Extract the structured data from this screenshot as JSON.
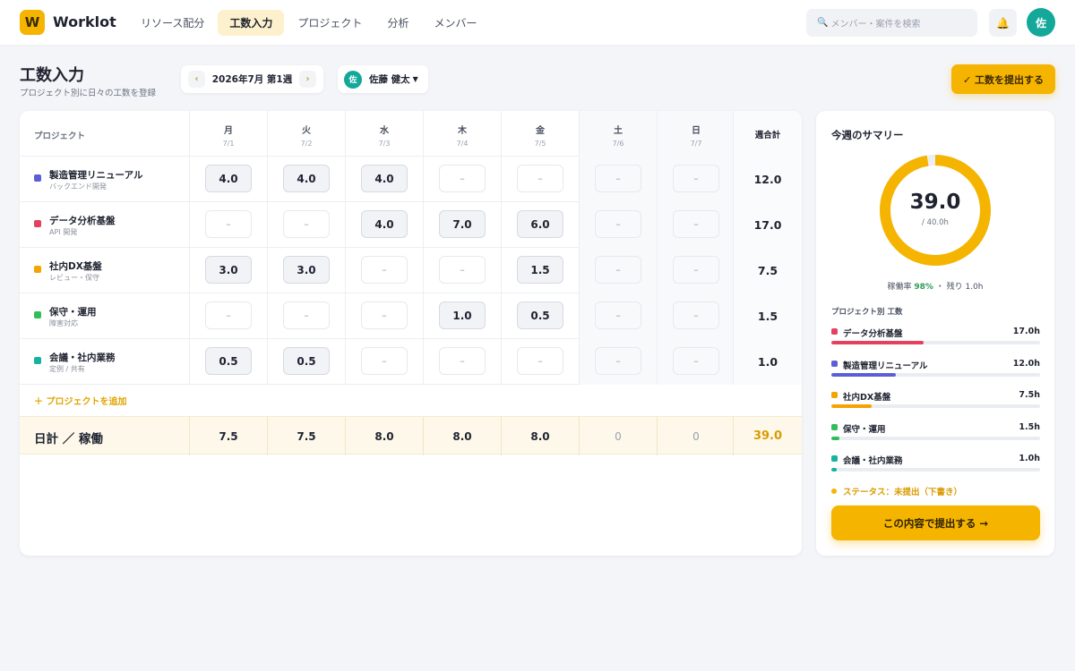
{
  "app": {
    "logo_letter": "W",
    "name": "Worklot"
  },
  "nav": [
    {
      "label": "リソース配分",
      "active": false
    },
    {
      "label": "工数入力",
      "active": true
    },
    {
      "label": "プロジェクト",
      "active": false
    },
    {
      "label": "分析",
      "active": false
    },
    {
      "label": "メンバー",
      "active": false
    }
  ],
  "search": {
    "placeholder": "メンバー・案件を検索",
    "icon": "search-icon"
  },
  "header_icons": {
    "bell": "bell-icon"
  },
  "user": {
    "initial": "佐",
    "name": "佐藤 健太"
  },
  "page": {
    "title": "工数入力",
    "subtitle": "プロジェクト別に日々の工数を登録",
    "week_label": "2026年7月 第1週",
    "prev": "‹",
    "next": "›",
    "submit_top": "✓ 工数を提出する"
  },
  "table": {
    "project_header": "プロジェクト",
    "total_header": "週合計",
    "days": [
      {
        "name": "月",
        "date": "7/1",
        "weekend": false
      },
      {
        "name": "火",
        "date": "7/2",
        "weekend": false
      },
      {
        "name": "水",
        "date": "7/3",
        "weekend": false
      },
      {
        "name": "木",
        "date": "7/4",
        "weekend": false
      },
      {
        "name": "金",
        "date": "7/5",
        "weekend": false
      },
      {
        "name": "土",
        "date": "7/6",
        "weekend": true
      },
      {
        "name": "日",
        "date": "7/7",
        "weekend": true
      }
    ],
    "rows": [
      {
        "name": "製造管理リニューアル",
        "sub": "バックエンド開発",
        "color": "#5b5fd6",
        "cells": [
          "4.0",
          "4.0",
          "4.0",
          "–",
          "–",
          "–",
          "–"
        ],
        "total": "12.0"
      },
      {
        "name": "データ分析基盤",
        "sub": "API 開発",
        "color": "#e5405e",
        "cells": [
          "–",
          "–",
          "4.0",
          "7.0",
          "6.0",
          "–",
          "–"
        ],
        "total": "17.0"
      },
      {
        "name": "社内DX基盤",
        "sub": "レビュー・保守",
        "color": "#f5a300",
        "cells": [
          "3.0",
          "3.0",
          "–",
          "–",
          "1.5",
          "–",
          "–"
        ],
        "total": "7.5"
      },
      {
        "name": "保守・運用",
        "sub": "障害対応",
        "color": "#2fbf5a",
        "cells": [
          "–",
          "–",
          "–",
          "1.0",
          "0.5",
          "–",
          "–"
        ],
        "total": "1.5"
      },
      {
        "name": "会議・社内業務",
        "sub": "定例 / 共有",
        "color": "#14b39e",
        "cells": [
          "0.5",
          "0.5",
          "–",
          "–",
          "–",
          "–",
          "–"
        ],
        "total": "1.0"
      }
    ],
    "add_project": "＋ プロジェクトを追加",
    "footer_label": "日計 ／ 稼働",
    "daily_totals": [
      "7.5",
      "7.5",
      "8.0",
      "8.0",
      "8.0",
      "0",
      "0"
    ],
    "grand_total": "39.0"
  },
  "summary": {
    "title": "今週のサマリー",
    "value": "39.0",
    "target": "/ 40.0h",
    "progress": 0.975,
    "accent": "#f5b400",
    "util_prefix": "稼働率 ",
    "util_pct": "98%",
    "util_suffix": " ・ 残り 1.0h",
    "by_project_label": "プロジェクト別 工数",
    "items": [
      {
        "name": "データ分析基盤",
        "hours": "17.0h",
        "value": 17.0,
        "color": "#e5405e"
      },
      {
        "name": "製造管理リニューアル",
        "hours": "12.0h",
        "value": 12.0,
        "color": "#5b5fd6"
      },
      {
        "name": "社内DX基盤",
        "hours": "7.5h",
        "value": 7.5,
        "color": "#f5a300"
      },
      {
        "name": "保守・運用",
        "hours": "1.5h",
        "value": 1.5,
        "color": "#2fbf5a"
      },
      {
        "name": "会議・社内業務",
        "hours": "1.0h",
        "value": 1.0,
        "color": "#14b39e"
      }
    ],
    "status": "ステータス：未提出（下書き）",
    "submit_button": "この内容で提出する →"
  }
}
